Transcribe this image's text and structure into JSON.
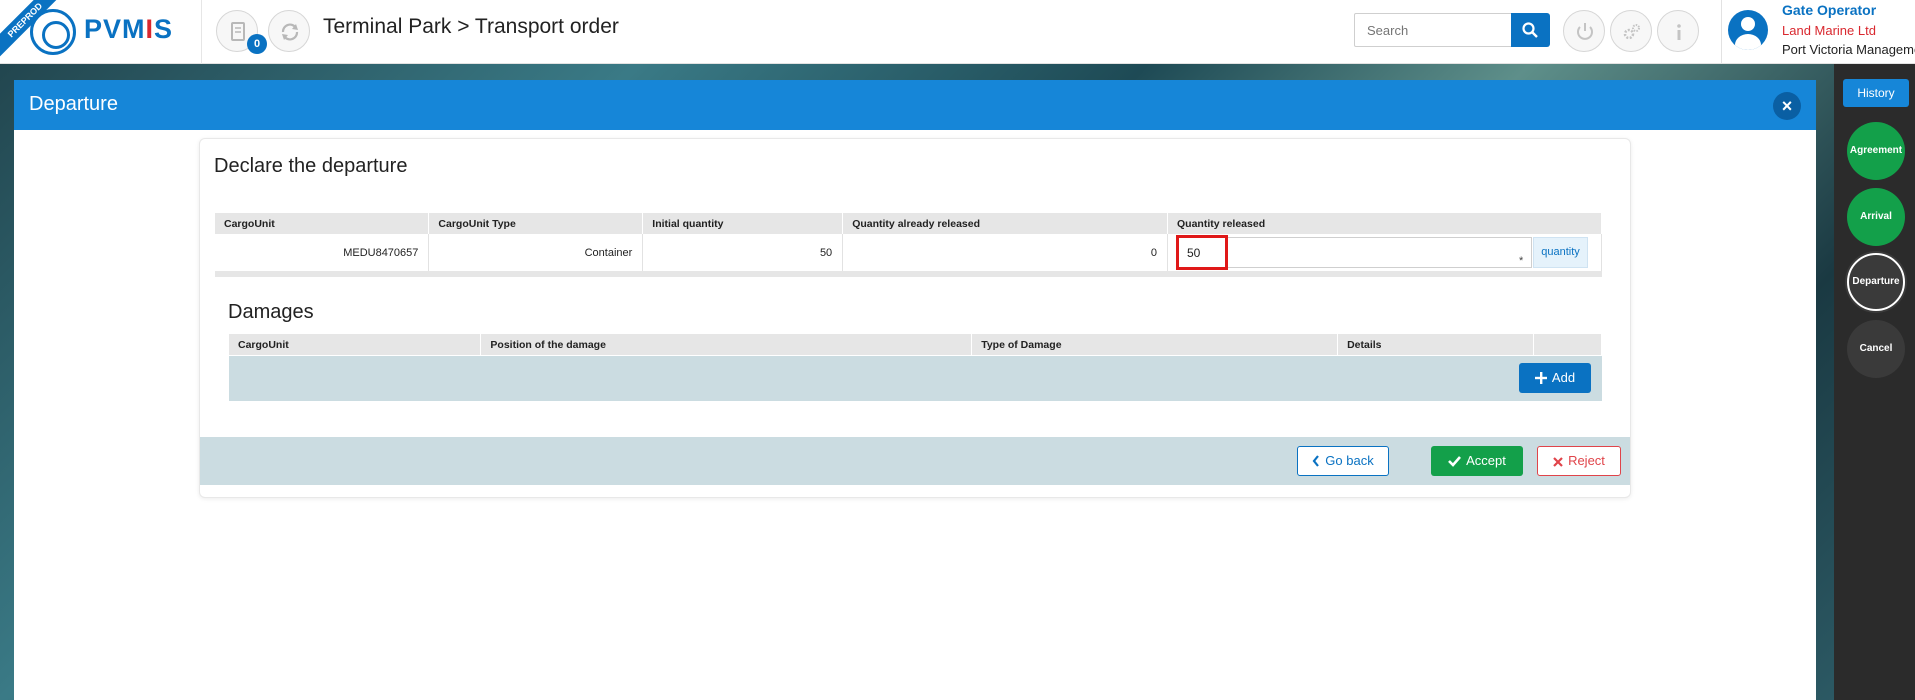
{
  "header": {
    "env_badge": "PREPROD",
    "logo": "PVMIS",
    "notifications_count": "0",
    "page_title": "Terminal Park > Transport order",
    "search_placeholder": "Search",
    "user": {
      "role": "Gate Operator",
      "company": "Land Marine Ltd",
      "organization": "Port Victoria Management"
    }
  },
  "modal": {
    "title": "Departure",
    "close_icon": "×",
    "section_title": "Declare the departure",
    "cargo_table": {
      "headers": [
        "CargoUnit",
        "CargoUnit Type",
        "Initial quantity",
        "Quantity already released",
        "Quantity released"
      ],
      "row": {
        "cargo_unit": "MEDU8470657",
        "type": "Container",
        "initial_quantity": "50",
        "already_released": "0",
        "quantity_released": "50",
        "required_marker": "*",
        "unit_addon": "quantity"
      }
    },
    "damages": {
      "title": "Damages",
      "headers": [
        "CargoUnit",
        "Position of the damage",
        "Type of Damage",
        "Details"
      ],
      "add_label": "Add"
    },
    "footer": {
      "go_back": "Go back",
      "accept": "Accept",
      "reject": "Reject"
    }
  },
  "history_panel": {
    "history_label": "History",
    "steps": [
      "Agreement",
      "Arrival",
      "Departure",
      "Cancel"
    ],
    "active_step": "Departure"
  },
  "colors": {
    "primary": "#0a72c2",
    "header_blue": "#1686d8",
    "accept_green": "#13a04a",
    "reject_red": "#e0444a",
    "highlight_red": "#e01818"
  }
}
